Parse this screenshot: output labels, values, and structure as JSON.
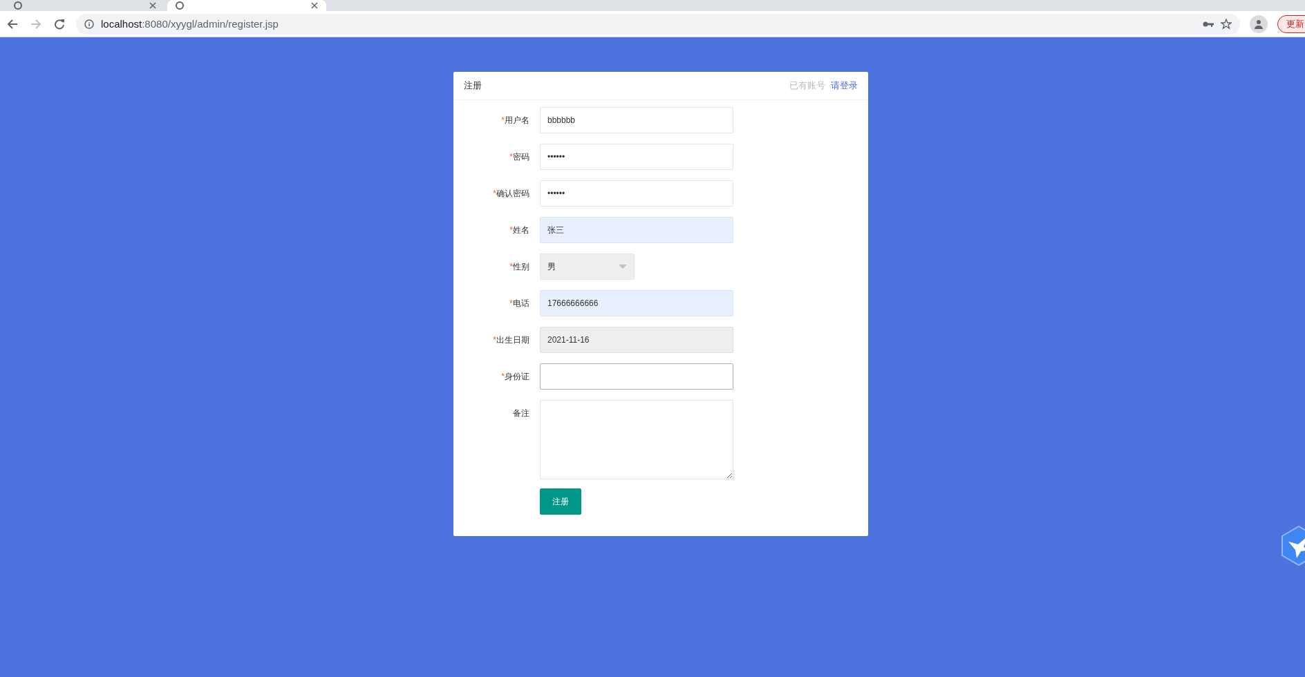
{
  "browser": {
    "tabs": [
      {
        "selected": false
      },
      {
        "selected": true
      }
    ],
    "url": {
      "host": "localhost",
      "rest": ":8080/xyygl/admin/register.jsp"
    },
    "update_button": "更新"
  },
  "card": {
    "title": "注册",
    "login_prompt": "已有账号",
    "login_link": "请登录",
    "fields": [
      {
        "kind": "text",
        "marker": "*",
        "label": "用户名",
        "value": "bbbbbb",
        "autofilled": false,
        "readonly": false,
        "focused": false
      },
      {
        "kind": "text",
        "marker": "*",
        "label": "密码",
        "value": "••••••",
        "autofilled": false,
        "readonly": false,
        "focused": false
      },
      {
        "kind": "text",
        "marker": "*",
        "label": "确认密码",
        "value": "••••••",
        "autofilled": false,
        "readonly": false,
        "focused": false
      },
      {
        "kind": "text",
        "marker": "*",
        "label": "姓名",
        "value": "张三",
        "autofilled": true,
        "readonly": false,
        "focused": false
      },
      {
        "kind": "select",
        "marker": "*",
        "label": "性别",
        "value": "男"
      },
      {
        "kind": "text",
        "marker": "*",
        "label": "电话",
        "value": "17666666666",
        "autofilled": true,
        "readonly": false,
        "focused": false
      },
      {
        "kind": "text",
        "marker": "*",
        "label": "出生日期",
        "value": "2021-11-16",
        "autofilled": false,
        "readonly": true,
        "focused": false
      },
      {
        "kind": "text",
        "marker": "*",
        "label": "身份证",
        "autofilled": false,
        "readonly": false,
        "focused": true
      },
      {
        "kind": "textarea",
        "label": "备注"
      }
    ],
    "submit": "注册"
  }
}
